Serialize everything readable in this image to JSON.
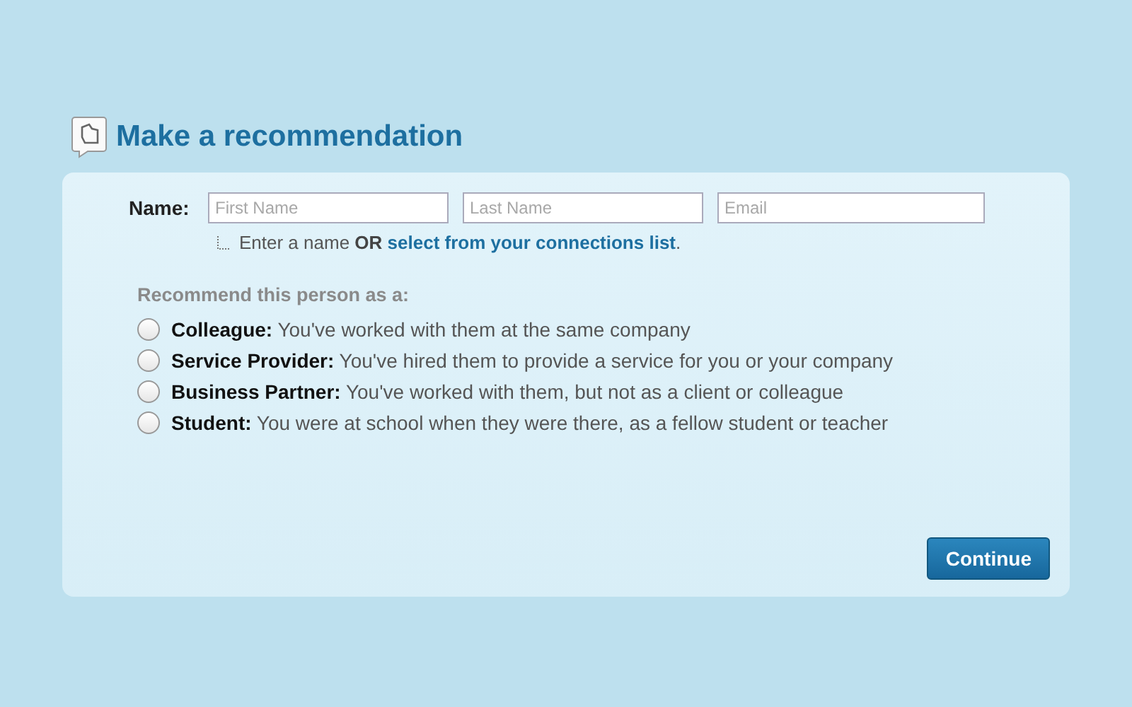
{
  "title": "Make a recommendation",
  "name_field": {
    "label": "Name:",
    "inputs": [
      {
        "placeholder": "First Name"
      },
      {
        "placeholder": "Last Name"
      },
      {
        "placeholder": "Email"
      }
    ]
  },
  "hint": {
    "text": "Enter a name **OR** ",
    "link": "select from your connections list",
    "after": "."
  },
  "options_heading": "Recommend this person as a:",
  "options": [
    {
      "text": "**Colleague:** You've worked with them at the same company",
      "selected": false
    },
    {
      "text": "**Service Provider:** You've hired them to provide a service for you or your company",
      "selected": false
    },
    {
      "text": "**Business Partner:** You've worked with them, but not as a client or colleague",
      "selected": false
    },
    {
      "text": "**Student:** You were at school when they were there, as a fellow student or teacher",
      "selected": false
    }
  ],
  "button": "Continue"
}
